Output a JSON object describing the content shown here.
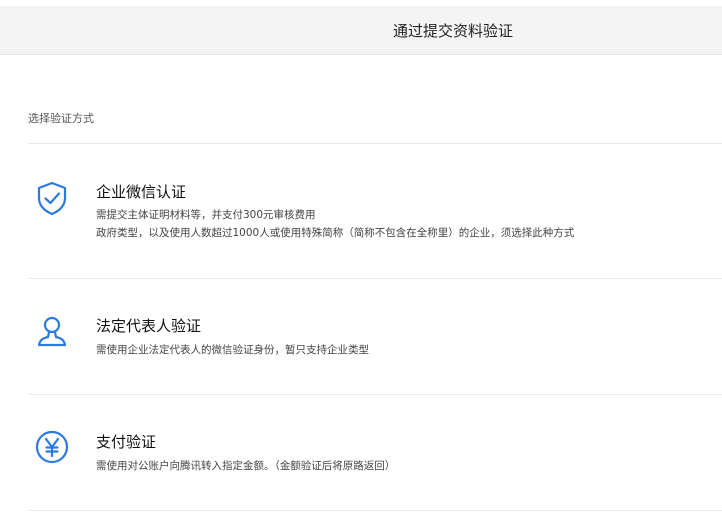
{
  "header": {
    "title": "通过提交资料验证"
  },
  "section_label": "选择验证方式",
  "options": [
    {
      "icon": "shield-check-icon",
      "title": "企业微信认证",
      "desc": [
        "需提交主体证明材料等，并支付300元审核费用",
        "政府类型，以及使用人数超过1000人或使用特殊简称（简称不包含在全称里）的企业，须选择此种方式"
      ]
    },
    {
      "icon": "person-icon",
      "title": "法定代表人验证",
      "desc": [
        "需使用企业法定代表人的微信验证身份，暂只支持企业类型"
      ]
    },
    {
      "icon": "yen-icon",
      "title": "支付验证",
      "desc": [
        "需使用对公账户向腾讯转入指定金额。（金额验证后将原路返回）"
      ]
    }
  ],
  "colors": {
    "accent": "#2a7ae2",
    "header_bg": "#f4f4f4",
    "divider": "#e9e9e9"
  }
}
